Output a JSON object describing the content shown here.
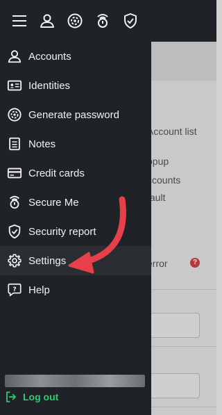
{
  "background": {
    "lines": [
      "Account list",
      "opup",
      "ccounts",
      "fault",
      "error"
    ]
  },
  "topbar": {
    "icons": [
      "hamburger-menu-icon",
      "user-icon",
      "password-generator-icon",
      "secure-me-icon",
      "security-shield-icon"
    ]
  },
  "menu": {
    "items": [
      {
        "label": "Accounts",
        "icon": "user-icon"
      },
      {
        "label": "Identities",
        "icon": "id-card-icon"
      },
      {
        "label": "Generate password",
        "icon": "password-generator-icon"
      },
      {
        "label": "Notes",
        "icon": "notes-icon"
      },
      {
        "label": "Credit cards",
        "icon": "credit-card-icon"
      },
      {
        "label": "Secure Me",
        "icon": "secure-me-icon"
      },
      {
        "label": "Security report",
        "icon": "security-shield-icon"
      },
      {
        "label": "Settings",
        "icon": "gear-icon"
      },
      {
        "label": "Help",
        "icon": "help-icon"
      }
    ],
    "active": "Settings"
  },
  "logout": {
    "label": "Log out",
    "icon": "logout-icon"
  },
  "colors": {
    "drawer": "#1f2327",
    "text": "#f2f2f2",
    "logout": "#2ecc71",
    "arrow": "#e8404a"
  }
}
